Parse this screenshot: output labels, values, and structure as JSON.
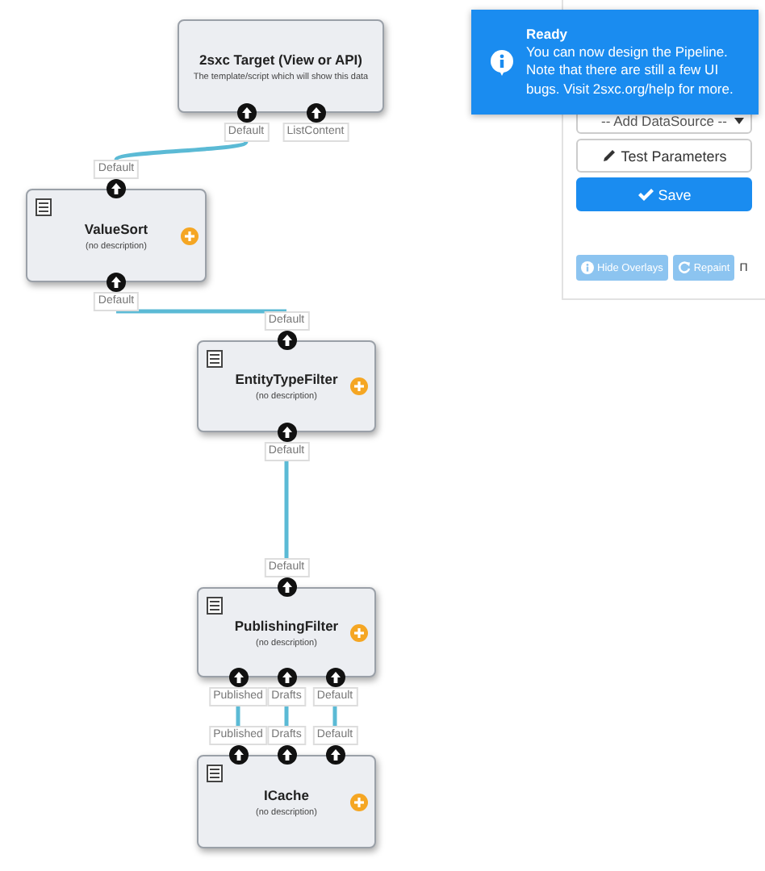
{
  "nodes": [
    {
      "kind": "target",
      "title": "2sxc Target (View or API)",
      "description": "The template/script which will show this data",
      "bottom_ports": [
        {
          "label": "Default",
          "connected": true
        },
        {
          "label": "ListContent",
          "connected": false
        }
      ]
    },
    {
      "kind": "datasource",
      "title": "ValueSort",
      "description": "(no description)",
      "top_ports": [
        {
          "label": "Default"
        }
      ],
      "bottom_ports": [
        {
          "label": "Default",
          "connected": true
        }
      ]
    },
    {
      "kind": "datasource",
      "title": "EntityTypeFilter",
      "description": "(no description)",
      "top_ports": [
        {
          "label": "Default"
        }
      ],
      "bottom_ports": [
        {
          "label": "Default",
          "connected": true
        }
      ]
    },
    {
      "kind": "datasource",
      "title": "PublishingFilter",
      "description": "(no description)",
      "top_ports": [
        {
          "label": "Default"
        }
      ],
      "bottom_ports": [
        {
          "label": "Published",
          "connected": true
        },
        {
          "label": "Drafts",
          "connected": true
        },
        {
          "label": "Default",
          "connected": true
        }
      ]
    },
    {
      "kind": "datasource",
      "title": "ICache",
      "description": "(no description)",
      "top_ports": [
        {
          "label": "Published"
        },
        {
          "label": "Drafts"
        },
        {
          "label": "Default"
        }
      ]
    }
  ],
  "panel": {
    "datasource_select": {
      "value": "-- Add DataSource --"
    },
    "actions": [
      {
        "kind": "edit",
        "label": "Test Parameters"
      },
      {
        "kind": "save",
        "label": "Save"
      }
    ],
    "tools": [
      {
        "kind": "info",
        "label": "Hide Overlays",
        "disabled": true
      },
      {
        "kind": "repaint",
        "label": "Repaint",
        "disabled": true
      }
    ],
    "cut_text": "Π"
  },
  "toast": {
    "title": "Ready",
    "message": "You can now design the Pipeline. Note that there are still a few UI bugs. Visit 2sxc.org/help for more."
  }
}
